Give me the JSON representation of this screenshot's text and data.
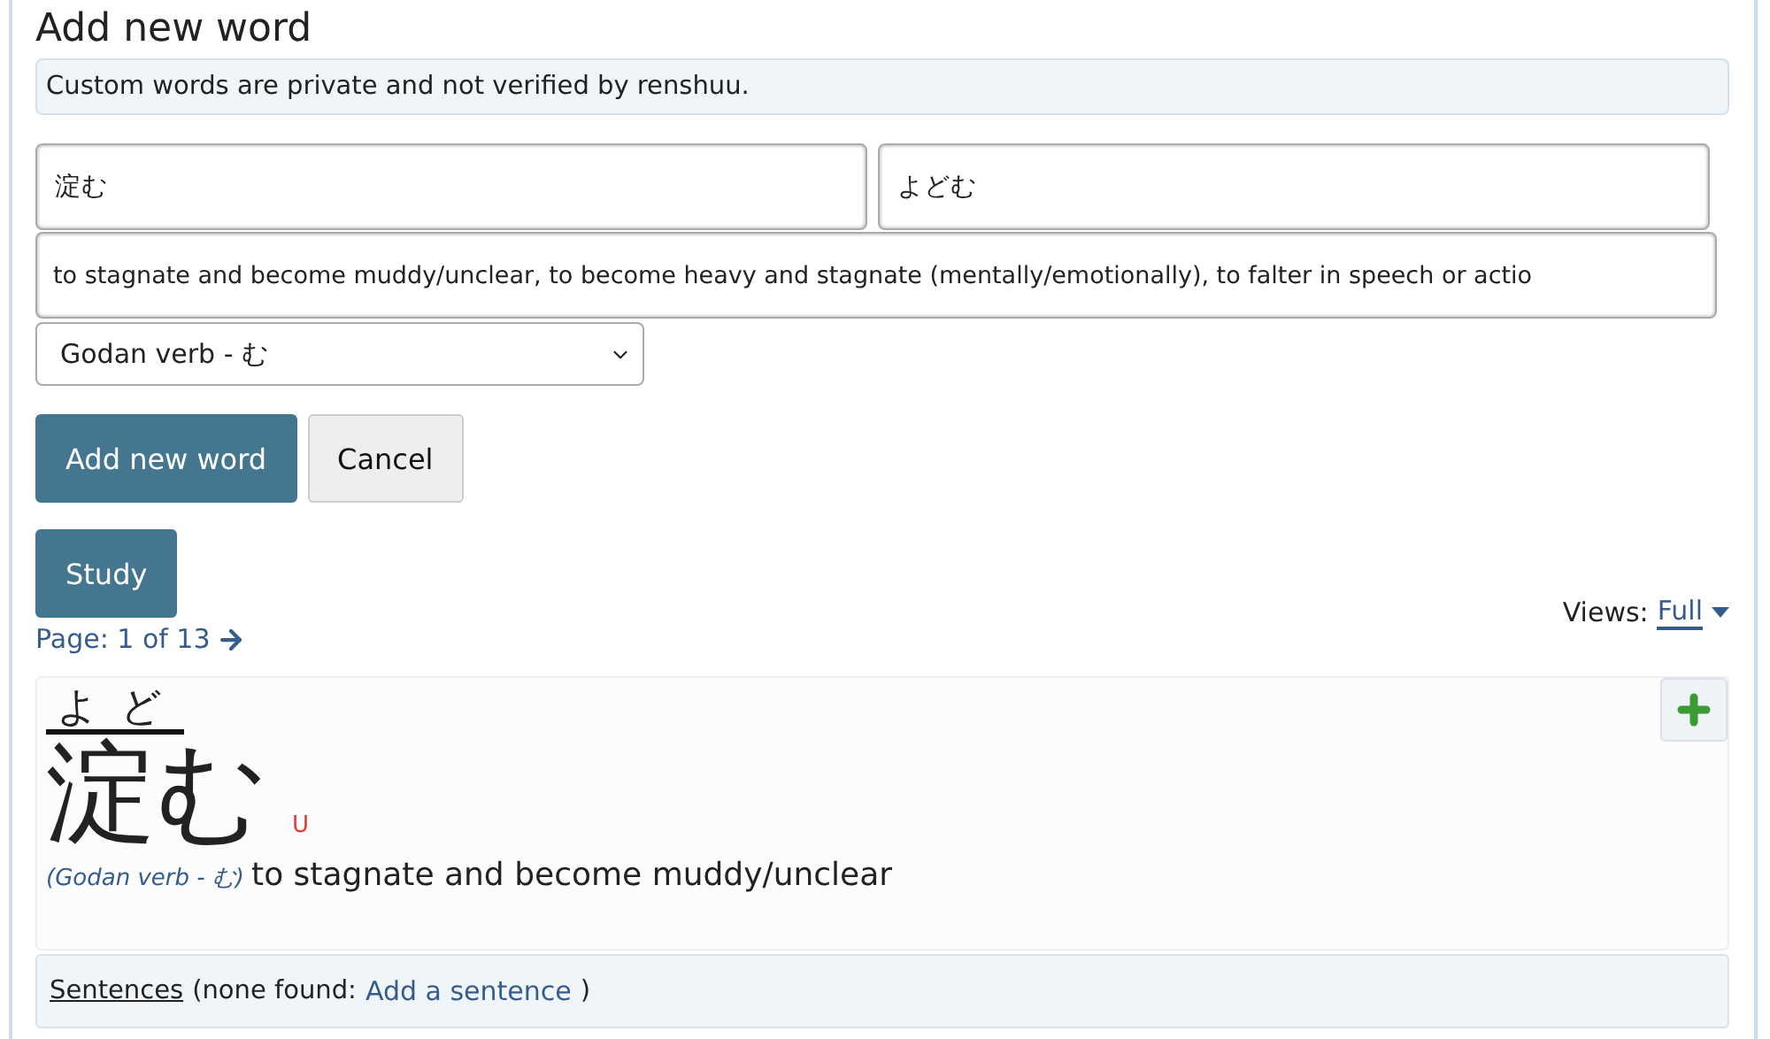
{
  "heading": "Add new word",
  "notice": "Custom words are private and not verified by renshuu.",
  "form": {
    "kanji_value": "淀む",
    "reading_value": "よどむ",
    "definition_value": "to stagnate and become muddy/unclear, to become heavy and stagnate (mentally/emotionally), to falter in speech or actio",
    "type_value": "Godan verb - む"
  },
  "buttons": [
    {
      "label": "Add new word",
      "kind": "primary"
    },
    {
      "label": "Cancel",
      "kind": "secondary"
    }
  ],
  "study_button": "Study",
  "pager": {
    "label": "Page: 1 of 13"
  },
  "views": {
    "label": "Views:",
    "value": "Full"
  },
  "word": {
    "furigana": "よど",
    "kanji": "淀む",
    "mark": "U",
    "type": "(Godan verb - む)",
    "definition": "to stagnate and become muddy/unclear"
  },
  "sentences": {
    "label": "Sentences",
    "note": "(none found:",
    "link": "Add a sentence",
    "close": ")"
  }
}
